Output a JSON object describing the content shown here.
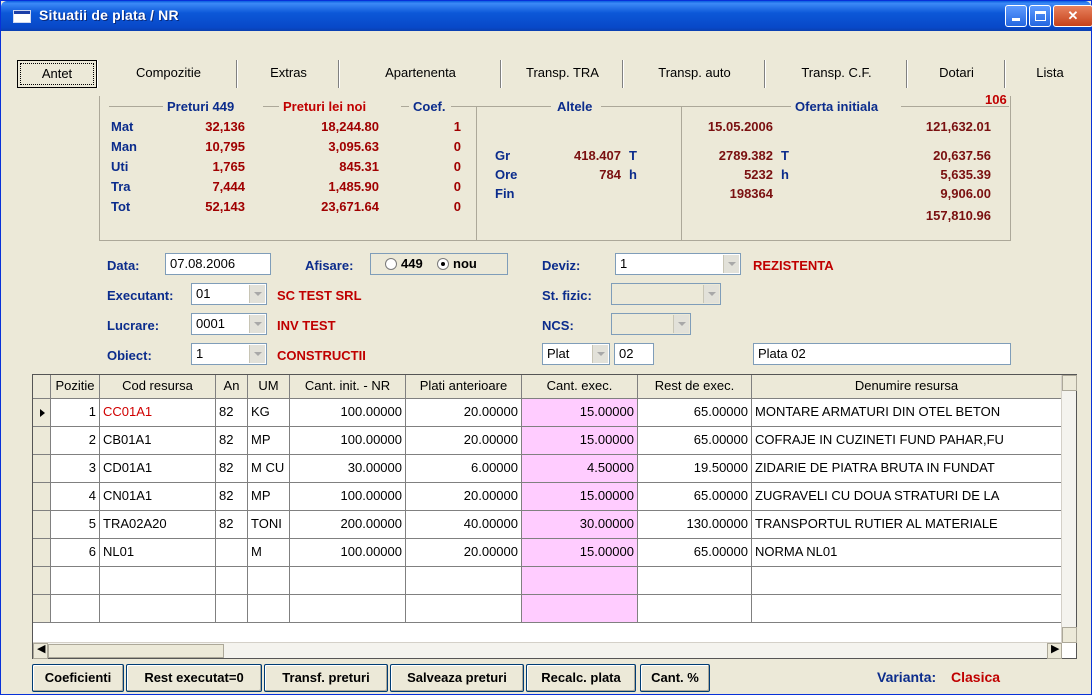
{
  "window": {
    "title": "Situatii de plata / NR"
  },
  "tabs": [
    {
      "label": "Antet",
      "active": true
    },
    {
      "label": "Compozitie"
    },
    {
      "label": "Extras"
    },
    {
      "label": "Apartenenta"
    },
    {
      "label": "Transp. TRA"
    },
    {
      "label": "Transp. auto"
    },
    {
      "label": "Transp. C.F."
    },
    {
      "label": "Dotari"
    },
    {
      "label": "Lista"
    }
  ],
  "summary": {
    "headers": {
      "preturi449": "Preturi 449",
      "preturi_lei_noi": "Preturi lei noi",
      "coef": "Coef.",
      "altele": "Altele",
      "oferta": "Oferta initiala",
      "count": "106"
    },
    "rows": [
      {
        "label": "Mat",
        "p449": "32,136",
        "plei": "18,244.80",
        "coef": "1"
      },
      {
        "label": "Man",
        "p449": "10,795",
        "plei": "3,095.63",
        "coef": "0"
      },
      {
        "label": "Uti",
        "p449": "1,765",
        "plei": "845.31",
        "coef": "0"
      },
      {
        "label": "Tra",
        "p449": "7,444",
        "plei": "1,485.90",
        "coef": "0"
      },
      {
        "label": "Tot",
        "p449": "52,143",
        "plei": "23,671.64",
        "coef": "0"
      }
    ],
    "altele": [
      {
        "label": "Gr",
        "value": "418.407",
        "unit": "T"
      },
      {
        "label": "Ore",
        "value": "784",
        "unit": "h"
      },
      {
        "label": "Fin",
        "value": "",
        "unit": ""
      }
    ],
    "oferta_left": [
      {
        "value": "15.05.2006",
        "unit": ""
      },
      {
        "value": "2789.382",
        "unit": "T"
      },
      {
        "value": "5232",
        "unit": "h"
      },
      {
        "value": "198364",
        "unit": ""
      }
    ],
    "oferta_right": [
      "121,632.01",
      "20,637.56",
      "5,635.39",
      "9,906.00",
      "157,810.96"
    ]
  },
  "form": {
    "data_label": "Data:",
    "data_value": "07.08.2006",
    "afisare_label": "Afisare:",
    "afisare_opt1": "449",
    "afisare_opt2": "nou",
    "executant_label": "Executant:",
    "executant_value": "01",
    "executant_name": "SC TEST SRL",
    "lucrare_label": "Lucrare:",
    "lucrare_value": "0001",
    "lucrare_name": "INV TEST",
    "obiect_label": "Obiect:",
    "obiect_value": "1",
    "obiect_name": "CONSTRUCTII",
    "deviz_label": "Deviz:",
    "deviz_value": "1",
    "deviz_name": "REZISTENTA",
    "stfizic_label": "St. fizic:",
    "ncs_label": "NCS:",
    "plat_value": "Plat",
    "plat_num": "02",
    "plata_name": "Plata 02"
  },
  "grid": {
    "columns": [
      "Pozitie",
      "Cod resursa",
      "An",
      "UM",
      "Cant. init. - NR",
      "Plati anterioare",
      "Cant. exec.",
      "Rest de exec.",
      "Denumire resursa"
    ],
    "rows": [
      [
        "1",
        "CC01A1",
        "82",
        "KG",
        "100.00000",
        "20.00000",
        "15.00000",
        "65.00000",
        "MONTARE ARMATURI DIN OTEL BETON"
      ],
      [
        "2",
        "CB01A1",
        "82",
        "MP",
        "100.00000",
        "20.00000",
        "15.00000",
        "65.00000",
        "COFRAJE IN CUZINETI FUND PAHAR,FU"
      ],
      [
        "3",
        "CD01A1",
        "82",
        "M CU",
        "30.00000",
        "6.00000",
        "4.50000",
        "19.50000",
        "ZIDARIE DE PIATRA BRUTA IN FUNDAT"
      ],
      [
        "4",
        "CN01A1",
        "82",
        "MP",
        "100.00000",
        "20.00000",
        "15.00000",
        "65.00000",
        "ZUGRAVELI CU DOUA STRATURI DE LA"
      ],
      [
        "5",
        "TRA02A20",
        "82",
        "TONI",
        "200.00000",
        "40.00000",
        "30.00000",
        "130.00000",
        "TRANSPORTUL RUTIER AL MATERIALE"
      ],
      [
        "6",
        "NL01",
        "",
        "M",
        "100.00000",
        "20.00000",
        "15.00000",
        "65.00000",
        "NORMA NL01"
      ]
    ]
  },
  "buttons": [
    "Coeficienti",
    "Rest executat=0",
    "Transf. preturi",
    "Salveaza preturi",
    "Recalc. plata",
    "Cant. %"
  ],
  "varianta": {
    "label": "Varianta:",
    "value": "Clasica"
  },
  "colors": {
    "accent_blue": "#0b2c8c",
    "accent_red": "#c00000",
    "pink_cell": "#ffccff"
  }
}
